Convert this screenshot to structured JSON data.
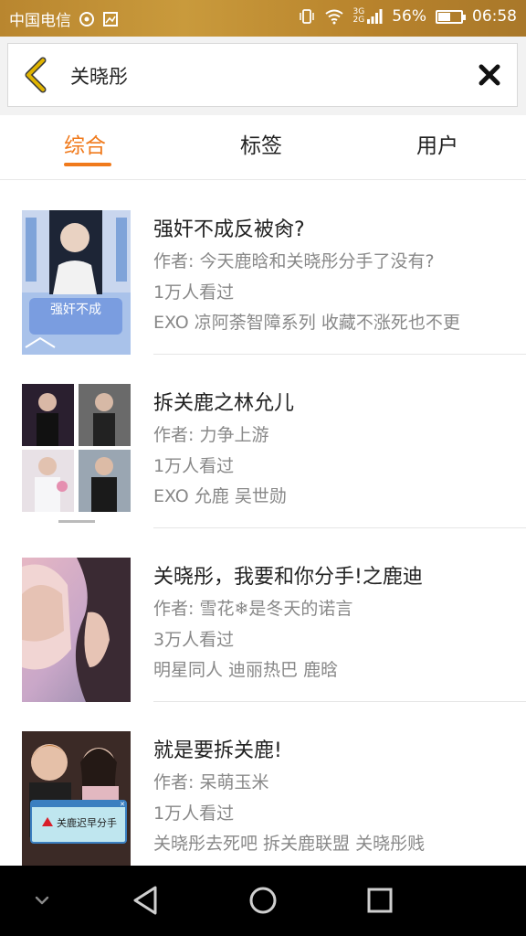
{
  "status_bar": {
    "carrier": "中国电信",
    "network_top": "3G",
    "network_bottom": "2G",
    "battery_percent": "56%",
    "battery_level": 0.56,
    "time": "06:58"
  },
  "search": {
    "query": "关晓彤"
  },
  "tabs": [
    {
      "label": "综合",
      "active": true
    },
    {
      "label": "标签",
      "active": false
    },
    {
      "label": "用户",
      "active": false
    }
  ],
  "results": [
    {
      "title": "强奸不成反被肏?",
      "author": "作者: 今天鹿晗和关晓彤分手了没有?",
      "views": "1万人看过",
      "tags": "EXO  凉阿荼智障系列  收藏不涨死也不更",
      "cover_text": "强奸不成"
    },
    {
      "title": "拆关鹿之林允儿",
      "author": "作者: 力争上游",
      "views": "1万人看过",
      "tags": "EXO  允鹿  吴世勋"
    },
    {
      "title": "关晓彤，我要和你分手!之鹿迪",
      "author": "作者: 雪花❄是冬天的诺言",
      "views": "3万人看过",
      "tags": "明星同人  迪丽热巴  鹿晗"
    },
    {
      "title": "就是要拆关鹿!",
      "author": "作者: 呆萌玉米",
      "views": "1万人看过",
      "tags": "关晓彤去死吧  拆关鹿联盟  关晓彤贱",
      "cover_text": "关鹿迟早分手"
    }
  ],
  "colors": {
    "accent": "#f07a1c",
    "status_bar": "#b9862f",
    "back_arrow": "#e0b400"
  }
}
